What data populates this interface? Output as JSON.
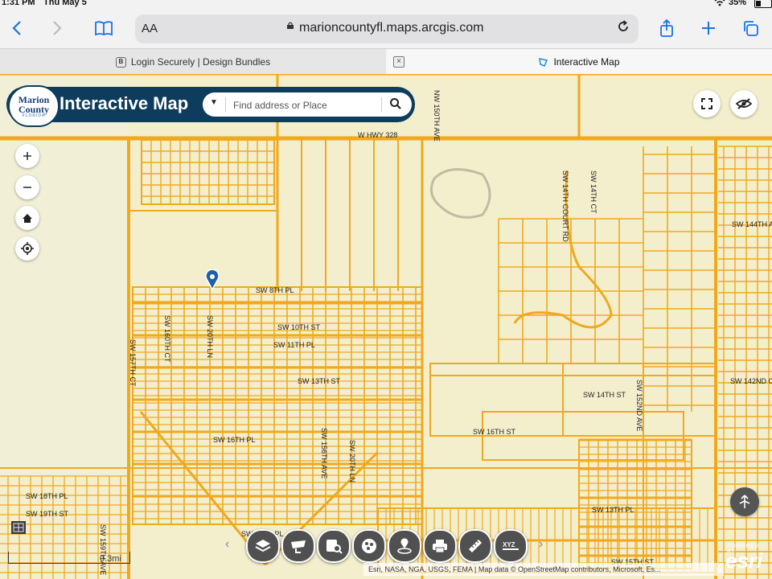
{
  "status_bar": {
    "time": "1:31 PM",
    "date": "Thu May 5",
    "battery": "35%"
  },
  "browser": {
    "reader_label": "AA",
    "url": "marioncountyfl.maps.arcgis.com",
    "icons": {
      "back": "chevron-left-icon",
      "forward": "chevron-right-icon",
      "bookmarks": "book-icon",
      "reload": "reload-icon",
      "share": "share-icon",
      "new_tab": "plus-icon",
      "tabs": "tabs-icon"
    },
    "tabs": [
      {
        "label": "Login Securely | Design Bundles",
        "active": false
      },
      {
        "label": "Interactive Map",
        "active": true
      }
    ]
  },
  "map_app": {
    "logo": {
      "line1": "Marion",
      "line2": "County",
      "line3": "FLORIDA"
    },
    "title": "Interactive Map",
    "search_placeholder": "Find address or Place",
    "scale_label": "0.3mi",
    "attribution": "Esri, NASA, NGA, USGS, FEMA | Map data © OpenStreetMap contributors, Microsoft, Es...",
    "powered_by": "POWERED BY",
    "esri_logo": "esri",
    "colors": {
      "header": "#0d3c5c",
      "parcel_lines": "#f0a81f",
      "map_background": "#f3efcd",
      "tool_button": "#505050"
    },
    "road_labels": [
      "W HWY 328",
      "NW 150TH AVE",
      "SW 14TH COURT RD",
      "SW 14TH CT",
      "SW 8TH PL",
      "SW 10TH ST",
      "SW 11TH PL",
      "SW 13TH ST",
      "SW 14TH ST",
      "SW 16TH ST",
      "SW 16TH PL",
      "SW 18TH PL",
      "SW 19TH ST",
      "SW 20TH LN",
      "SW 157TH CT",
      "SW 159TH AVE",
      "SW 160TH CT",
      "SW 156TH AVE",
      "SW 152ND AVE",
      "SW 144TH AVE",
      "SW 142ND CT",
      "SW 13TH PL",
      "SW 15TH ST",
      "SW 19TH PL",
      "SW 20TH LN",
      "SW 154TH CT",
      "SW 148TH AVE"
    ],
    "tools": [
      "layers-icon",
      "basemap-icon",
      "query-icon",
      "legend-icon",
      "location-search-icon",
      "print-icon",
      "measure-icon",
      "coordinates-icon"
    ]
  }
}
